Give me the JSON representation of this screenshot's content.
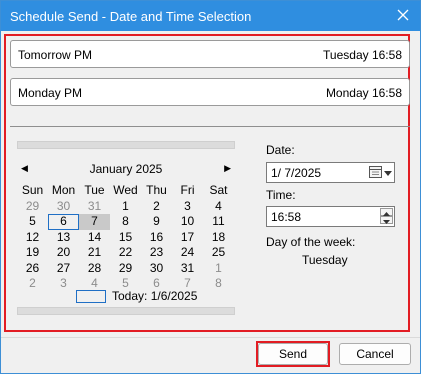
{
  "window": {
    "title": "Schedule Send - Date and Time Selection"
  },
  "quick_options": [
    {
      "left": "Tomorrow  PM",
      "right": "Tuesday  16:58"
    },
    {
      "left": "Monday  PM",
      "right": "Monday  16:58"
    }
  ],
  "calendar": {
    "month_label": "January 2025",
    "weekdays": [
      "Sun",
      "Mon",
      "Tue",
      "Wed",
      "Thu",
      "Fri",
      "Sat"
    ],
    "weeks": [
      [
        "29",
        "30",
        "31",
        "1",
        "2",
        "3",
        "4"
      ],
      [
        "5",
        "6",
        "7",
        "8",
        "9",
        "10",
        "11"
      ],
      [
        "12",
        "13",
        "14",
        "15",
        "16",
        "17",
        "18"
      ],
      [
        "19",
        "20",
        "21",
        "22",
        "23",
        "24",
        "25"
      ],
      [
        "26",
        "27",
        "28",
        "29",
        "30",
        "31",
        "1"
      ],
      [
        "2",
        "3",
        "4",
        "5",
        "6",
        "7",
        "8"
      ]
    ],
    "today_label": "Today: 1/6/2025"
  },
  "date": {
    "label": "Date:",
    "value": "1/  7/2025"
  },
  "time": {
    "label": "Time:",
    "value": "16:58"
  },
  "day_of_week": {
    "label": "Day of the week:",
    "value": "Tuesday"
  },
  "buttons": {
    "send": "Send",
    "cancel": "Cancel"
  },
  "icons": {
    "close": "close-icon",
    "calendar": "calendar-icon",
    "dropdown": "chevron-down-icon",
    "prev": "prev-month-icon",
    "next": "next-month-icon",
    "spin_up": "spin-up-icon",
    "spin_down": "spin-down-icon"
  },
  "colors": {
    "titlebar": "#2f8ee0",
    "highlight_frame": "#e21c23",
    "today_outline": "#1f6fc5",
    "selected_day": "#c9c9c9"
  }
}
